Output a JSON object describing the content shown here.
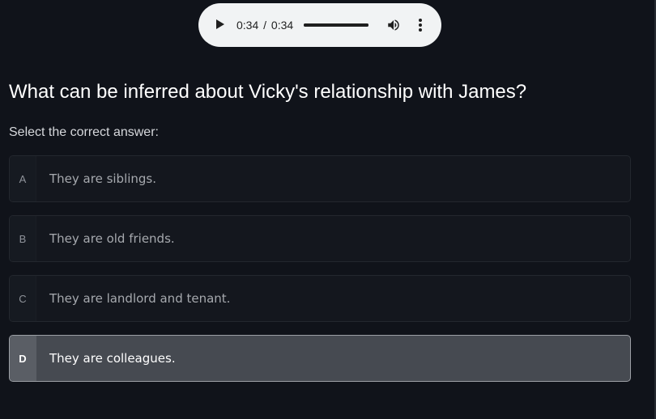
{
  "audio": {
    "current_time": "0:34",
    "separator": "/",
    "duration": "0:34",
    "progress": 1.0
  },
  "question": "What can be inferred about Vicky's relationship with James?",
  "instruction": "Select the correct answer:",
  "options": [
    {
      "letter": "A",
      "text": "They are siblings."
    },
    {
      "letter": "B",
      "text": "They are old friends."
    },
    {
      "letter": "C",
      "text": "They are landlord and tenant."
    },
    {
      "letter": "D",
      "text": "They are colleagues."
    }
  ],
  "selected_option": "D",
  "colors": {
    "background": "#10131a",
    "selected_background": "#464a51",
    "selected_border": "#9c9fa5"
  }
}
